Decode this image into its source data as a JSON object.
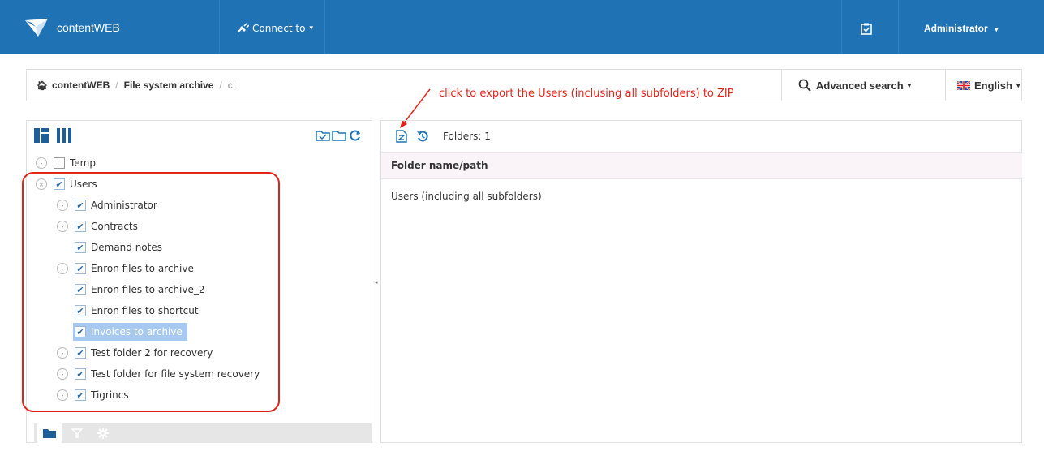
{
  "navbar": {
    "brand": "contentWEB",
    "connect_label": "Connect to",
    "user_label": "Administrator",
    "colors": {
      "background": "#1f73b5",
      "text": "#ffffff"
    }
  },
  "breadcrumb": {
    "items": [
      "contentWEB",
      "File system archive",
      "c:"
    ]
  },
  "search": {
    "advanced_label": "Advanced search"
  },
  "language": {
    "selected": "English"
  },
  "annotation": {
    "text": "click to export the Users (inclusing all subfolders) to ZIP",
    "color": "#e2231a"
  },
  "tree": {
    "nodes": [
      {
        "label": "Temp",
        "checked": false,
        "expandable": true,
        "selected": false
      },
      {
        "label": "Users",
        "checked": true,
        "expandable": true,
        "selected": false
      },
      {
        "label": "Administrator",
        "checked": true,
        "expandable": true,
        "selected": false
      },
      {
        "label": "Contracts",
        "checked": true,
        "expandable": true,
        "selected": false
      },
      {
        "label": "Demand notes",
        "checked": true,
        "expandable": false,
        "selected": false
      },
      {
        "label": "Enron files to archive",
        "checked": true,
        "expandable": true,
        "selected": false
      },
      {
        "label": "Enron files to archive_2",
        "checked": true,
        "expandable": false,
        "selected": false
      },
      {
        "label": "Enron files to shortcut",
        "checked": true,
        "expandable": false,
        "selected": false
      },
      {
        "label": "Invoices to archive",
        "checked": true,
        "expandable": false,
        "selected": true
      },
      {
        "label": "Test folder 2 for recovery",
        "checked": true,
        "expandable": true,
        "selected": false
      },
      {
        "label": "Test folder for file system recovery",
        "checked": true,
        "expandable": true,
        "selected": false
      },
      {
        "label": "Tigrincs",
        "checked": true,
        "expandable": true,
        "selected": false
      }
    ]
  },
  "right_panel": {
    "folders_count": "Folders: 1",
    "column_header": "Folder name/path",
    "rows": [
      "Users (including all subfolders)"
    ]
  }
}
